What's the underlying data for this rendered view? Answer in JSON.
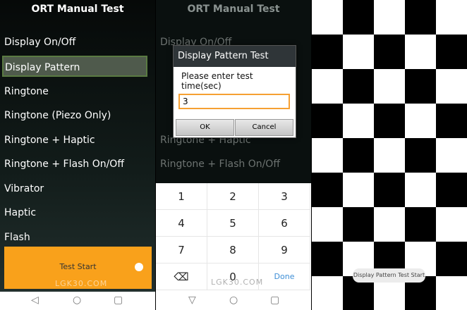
{
  "app_title": "ORT Manual Test",
  "menu": [
    "Display On/Off",
    "Display Pattern",
    "Ringtone",
    "Ringtone (Piezo Only)",
    "Ringtone + Haptic",
    "Ringtone + Flash On/Off",
    "Vibrator",
    "Haptic",
    "Flash"
  ],
  "selected_item": "Display Pattern",
  "test_start_label": "Test Start",
  "watermark": "LGK30.COM",
  "dialog": {
    "title": "Display Pattern Test",
    "message": "Please enter test time(sec)",
    "input_value": "3",
    "ok_label": "OK",
    "cancel_label": "Cancel"
  },
  "keypad": [
    "1",
    "2",
    "3",
    "4",
    "5",
    "6",
    "7",
    "8",
    "9",
    "⌫",
    "0",
    "Done"
  ],
  "toast": "Display Pattern Test Start",
  "nav_icons": [
    "back-icon",
    "home-icon",
    "recents-icon"
  ],
  "colors": {
    "accent_orange": "#f9a11b",
    "done_blue": "#3d8ed6"
  }
}
